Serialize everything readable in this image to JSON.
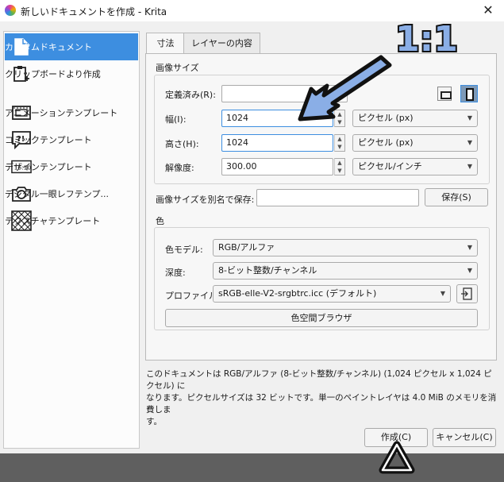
{
  "window": {
    "title": "新しいドキュメントを作成 - Krita",
    "close_glyph": "✕"
  },
  "sidebar": {
    "items": [
      {
        "label": "カスタムドキュメント",
        "icon": "document-icon"
      },
      {
        "label": "クリップボードより作成",
        "icon": "clipboard-icon"
      },
      {
        "label": "アニメーションテンプレート",
        "icon": "animation-icon"
      },
      {
        "label": "コミックテンプレート",
        "icon": "comic-icon"
      },
      {
        "label": "デザインテンプレート",
        "icon": "design-icon",
        "icon_text": "16:10"
      },
      {
        "label": "デジタル一眼レフテンプ...",
        "icon": "camera-icon"
      },
      {
        "label": "テクスチャテンプレート",
        "icon": "texture-icon"
      }
    ]
  },
  "tabs": [
    {
      "label": "寸法"
    },
    {
      "label": "レイヤーの内容"
    }
  ],
  "image_size": {
    "section_title": "画像サイズ",
    "preset_label": "定義済み(R):",
    "width_label": "幅(I):",
    "width_value": "1024",
    "height_label": "高さ(H):",
    "height_value": "1024",
    "resolution_label": "解像度:",
    "resolution_value": "300.00",
    "unit_px": "ピクセル (px)",
    "unit_res": "ピクセル/インチ",
    "save_as_label": "画像サイズを別名で保存:",
    "save_button": "保存(S)"
  },
  "color": {
    "section_title": "色",
    "model_label": "色モデル:",
    "model_value": "RGB/アルファ",
    "depth_label": "深度:",
    "depth_value": "8-ビット整数/チャンネル",
    "profile_label": "プロファイル:",
    "profile_value": "sRGB-elle-V2-srgbtrc.icc (デフォルト)",
    "browser_button": "色空間ブラウザ"
  },
  "info_text_line1": "このドキュメントは RGB/アルファ (8-ビット整数/チャンネル) (1,024 ピクセル x 1,024 ピクセル) に",
  "info_text_line2": "なります。ピクセルサイズは 32 ビットです。単一のペイントレイヤは 4.0 MiB のメモリを消費しま",
  "info_text_line3": "す。",
  "buttons": {
    "create": "作成(C)",
    "cancel": "キャンセル(C)"
  },
  "annotation": {
    "ratio_text": "1:1"
  },
  "colors": {
    "accent": "#3d8ee0",
    "annotation_fill": "#8aaee6",
    "annotation_stroke": "#111111"
  }
}
